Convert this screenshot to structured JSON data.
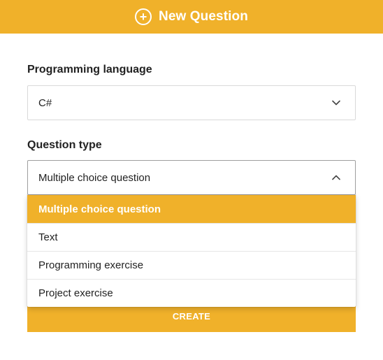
{
  "header": {
    "title": "New Question",
    "icon": "plus-circle-icon",
    "color": "#f0b12a"
  },
  "form": {
    "language": {
      "label": "Programming language",
      "value": "C#"
    },
    "question_type": {
      "label": "Question type",
      "value": "Multiple choice question",
      "options": [
        "Multiple choice question",
        "Text",
        "Programming exercise",
        "Project exercise"
      ]
    },
    "create_label": "CREATE"
  }
}
